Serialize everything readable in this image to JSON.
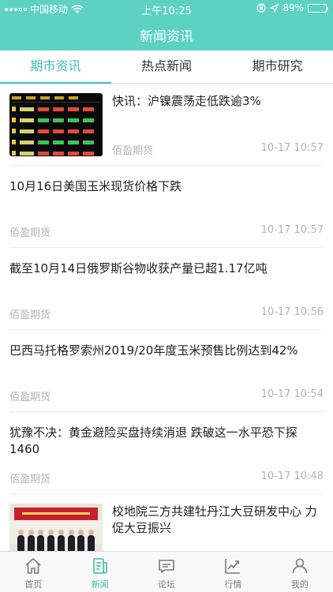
{
  "status_bar": {
    "carrier": "中国移动",
    "time": "上午10:25",
    "battery": "89%",
    "battery_level": 0.89
  },
  "header": {
    "title": "新闻资讯"
  },
  "tabs": [
    {
      "label": "期市资讯",
      "active": true
    },
    {
      "label": "热点新闻",
      "active": false
    },
    {
      "label": "期市研究",
      "active": false
    }
  ],
  "news": [
    {
      "title": "快讯：沪镍震荡走低跌逾3%",
      "source": "佰盈期货",
      "time": "10-17 10:57",
      "thumb": "quote-screen-image"
    },
    {
      "title": "10月16日美国玉米现货价格下跌",
      "source": "佰盈期货",
      "time": "10-17 10:57"
    },
    {
      "title": "截至10月14日俄罗斯谷物收获产量已超1.17亿吨",
      "source": "佰盈期货",
      "time": "10-17 10:56"
    },
    {
      "title": "巴西马托格罗索州2019/20年度玉米预售比例达到42%",
      "source": "佰盈期货",
      "time": "10-17 10:54"
    },
    {
      "title": "犹豫不决：黄金避险买盘持续消退 跌破这一水平恐下探1460",
      "source": "佰盈期货",
      "time": "10-17 10:48"
    },
    {
      "title": "校地院三方共建牡丹江大豆研发中心 力促大豆振兴",
      "source": "",
      "time": "",
      "thumb": "ceremony-photo-image"
    }
  ],
  "bottom_nav": [
    {
      "label": "首页",
      "icon": "home-icon",
      "active": false
    },
    {
      "label": "新闻",
      "icon": "news-icon",
      "active": true
    },
    {
      "label": "论坛",
      "icon": "forum-icon",
      "active": false
    },
    {
      "label": "行情",
      "icon": "chart-icon",
      "active": false
    },
    {
      "label": "我的",
      "icon": "user-icon",
      "active": false
    }
  ],
  "colors": {
    "accent": "#5dd2c3",
    "tab_active": "#3fbfb0",
    "meta_text": "#b3b3b3"
  }
}
